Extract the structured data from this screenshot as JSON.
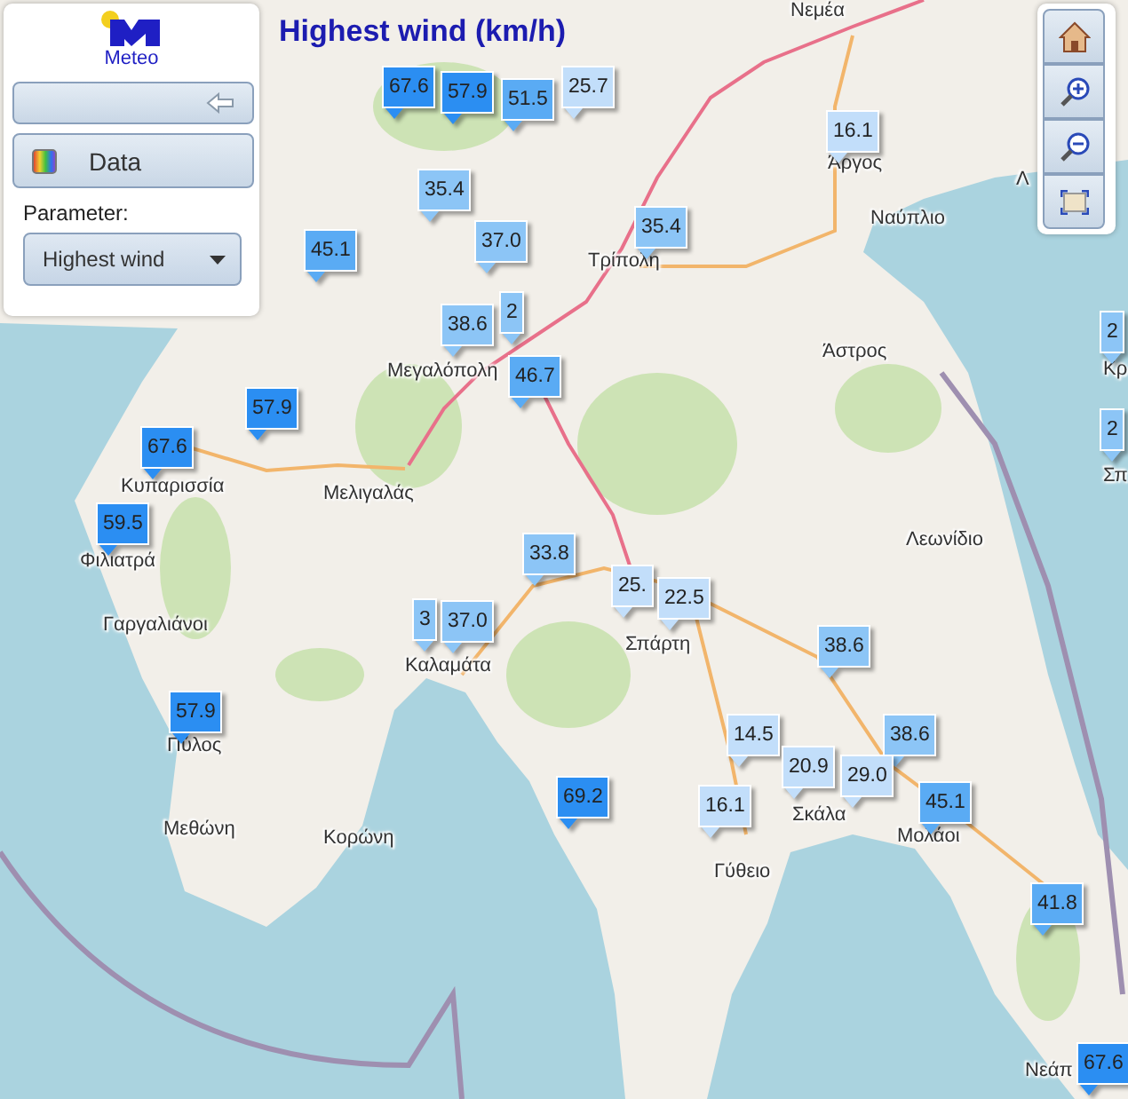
{
  "logo": {
    "text": "Meteo"
  },
  "title": "Highest wind (km/h)",
  "panel": {
    "data_button": "Data",
    "parameter_label": "Parameter:",
    "parameter_select": {
      "value": "Highest wind"
    }
  },
  "places": [
    {
      "name": "Νεμέα"
    },
    {
      "name": "Άργος"
    },
    {
      "name": "Ναύπλιο"
    },
    {
      "name": "Λ"
    },
    {
      "name": "Τρίπολη"
    },
    {
      "name": "Άστρος"
    },
    {
      "name": "Μεγαλόπολη"
    },
    {
      "name": "Κυπαρισσία"
    },
    {
      "name": "Μελιγαλάς"
    },
    {
      "name": "Φιλιατρά"
    },
    {
      "name": "Γαργαλιάνοι"
    },
    {
      "name": "Καλαμάτα"
    },
    {
      "name": "Σπάρτη"
    },
    {
      "name": "Λεωνίδιο"
    },
    {
      "name": "Πύλος"
    },
    {
      "name": "Μεθώνη"
    },
    {
      "name": "Κορώνη"
    },
    {
      "name": "Σκάλα"
    },
    {
      "name": "Μολάοι"
    },
    {
      "name": "Γύθειο"
    },
    {
      "name": "Νεάπ"
    },
    {
      "name": "Κρ"
    },
    {
      "name": "Σπ"
    }
  ],
  "stations": [
    {
      "value": "67.6",
      "color": "#2b8ef2"
    },
    {
      "value": "57.9",
      "color": "#2b8ef2"
    },
    {
      "value": "51.5",
      "color": "#5aabf4"
    },
    {
      "value": "25.7",
      "color": "#c2defa"
    },
    {
      "value": "16.1",
      "color": "#c2defa"
    },
    {
      "value": "35.4",
      "color": "#8cc5f6"
    },
    {
      "value": "37.0",
      "color": "#8cc5f6"
    },
    {
      "value": "45.1",
      "color": "#5aabf4"
    },
    {
      "value": "35.4",
      "color": "#8cc5f6"
    },
    {
      "value": "2",
      "color": "#8cc5f6"
    },
    {
      "value": "38.6",
      "color": "#8cc5f6"
    },
    {
      "value": "2",
      "color": "#8cc5f6"
    },
    {
      "value": "46.7",
      "color": "#5aabf4"
    },
    {
      "value": "57.9",
      "color": "#2b8ef2"
    },
    {
      "value": "2",
      "color": "#8cc5f6"
    },
    {
      "value": "67.6",
      "color": "#2b8ef2"
    },
    {
      "value": "59.5",
      "color": "#2b8ef2"
    },
    {
      "value": "33.8",
      "color": "#8cc5f6"
    },
    {
      "value": "25.",
      "color": "#c2defa"
    },
    {
      "value": "22.5",
      "color": "#c2defa"
    },
    {
      "value": "3",
      "color": "#8cc5f6"
    },
    {
      "value": "37.0",
      "color": "#8cc5f6"
    },
    {
      "value": "38.6",
      "color": "#8cc5f6"
    },
    {
      "value": "57.9",
      "color": "#2b8ef2"
    },
    {
      "value": "14.5",
      "color": "#c2defa"
    },
    {
      "value": "38.6",
      "color": "#8cc5f6"
    },
    {
      "value": "20.9",
      "color": "#c2defa"
    },
    {
      "value": "29.0",
      "color": "#c2defa"
    },
    {
      "value": "69.2",
      "color": "#2b8ef2"
    },
    {
      "value": "16.1",
      "color": "#c2defa"
    },
    {
      "value": "45.1",
      "color": "#5aabf4"
    },
    {
      "value": "41.8",
      "color": "#5aabf4"
    },
    {
      "value": "67.6",
      "color": "#2b8ef2"
    }
  ]
}
